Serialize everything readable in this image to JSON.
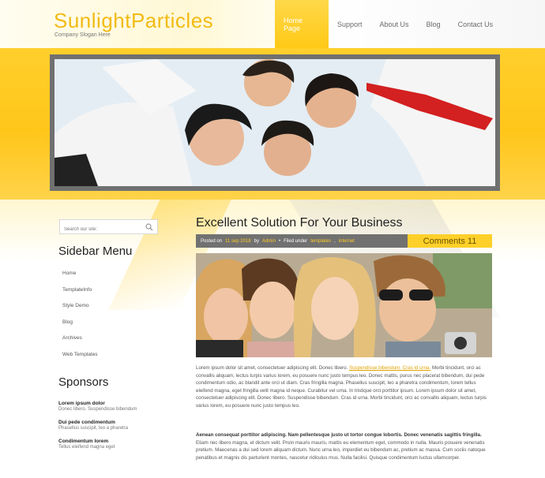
{
  "site": {
    "logo": "SunlightParticles",
    "slogan": "Company Slogan Here"
  },
  "nav": {
    "items": [
      {
        "label": "Home Page",
        "active": true
      },
      {
        "label": "Support",
        "active": false
      },
      {
        "label": "About Us",
        "active": false
      },
      {
        "label": "Blog",
        "active": false
      },
      {
        "label": "Contact Us",
        "active": false
      }
    ]
  },
  "sidebar": {
    "search_placeholder": "Search our site:",
    "menu_heading": "Sidebar Menu",
    "menu_items": [
      "Home",
      "TemplateInfo",
      "Style Demo",
      "Blog",
      "Archives",
      "Web Templates"
    ],
    "sponsors_heading": "Sponsors",
    "sponsors": [
      {
        "title": "Lorem ipsum dolor",
        "desc": "Donec libero. Suspendisse bibendum"
      },
      {
        "title": "Dui pede condimentum",
        "desc": "Phasellus suscipit, leo a pharetra"
      },
      {
        "title": "Condimentum lorem",
        "desc": "Tellus eleifend magna eget"
      }
    ]
  },
  "post": {
    "title": "Excellent Solution For Your Business",
    "meta": {
      "posted_on_label": "Posted on",
      "date": "11 sep 2018",
      "by_label": "by",
      "author": "Admin",
      "filed_label": "Filed under",
      "tag1": "templates",
      "tag2": "internet"
    },
    "comments_label": "Comments 11",
    "para1_start": "Lorem ipsum dolor sit amet, consectetuer adipiscing elit. Donec libero.",
    "para1_link": "Suspendisse bibendum. Cras id urna.",
    "para1_rest": "Morbi tincidunt, orci ac convallis aliquam, lectus turpis varius lorem, eu posuere nunc justo tempus leo. Donec mattis, purus nec placerat bibendum, dui pede condimentum odio, ac blandit ante orci ut diam. Cras fringilla magna. Phasellus suscipit, leo a pharetra condimentum, lorem tellus eleifend magna, eget fringilla velit magna id neque. Curabitur vel urna. In tristique orci porttitor ipsum. Lorem ipsum dolor sit amet, consectetuer adipiscing elit. Donec libero. Suspendisse bibendum. Cras id urna. Morbi tincidunt, orci ac convallis aliquam, lectus turpis varius lorem, eu posuere nunc justo tempus leo.",
    "para2_bold": "Aenean consequat porttitor adipiscing. Nam pellentesque justo ut tortor congue lobortis. Donec venenatis sagittis fringilla.",
    "para2_rest": "Etiam nec libero magna, et dictum velit. Proin mauris mauris, mattis eu elementum eget, commodo in nulla. Mauris posuere venenatis pretium. Maecenas a dui sed lorem aliquam dictum. Nunc urna leo, imperdiet eu bibendum ac, pretium ac massa. Cum sociis natoque penatibus et magnis dis parturient montes, nascetur ridiculus mus. Nulla facilisi. Quisque condimentum luctus ullamcorper."
  },
  "colors": {
    "accent": "#ffc916",
    "logo": "#f2bb12",
    "meta_bar": "#717171",
    "comments_box": "#ffd02a"
  }
}
